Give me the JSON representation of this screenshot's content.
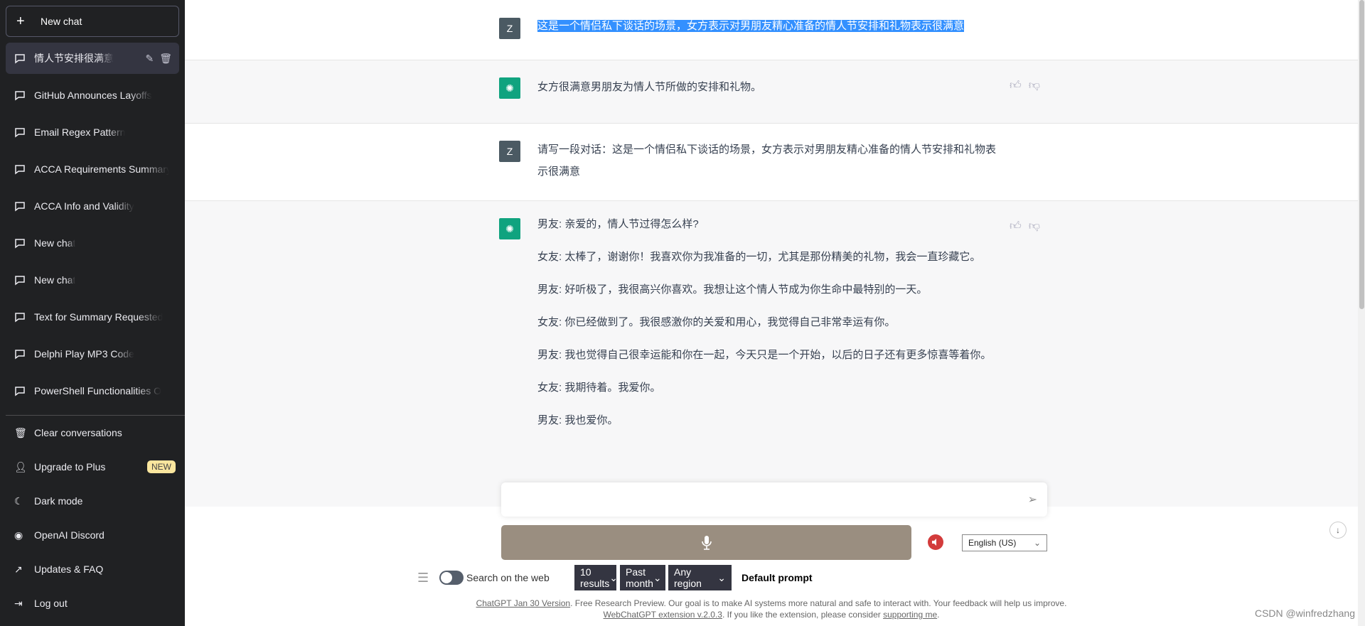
{
  "sidebar": {
    "new_chat": "New chat",
    "conversations": [
      {
        "label": "情人节安排很满意",
        "selected": true
      },
      {
        "label": "GitHub Announces Layoffs"
      },
      {
        "label": "Email Regex Pattern"
      },
      {
        "label": "ACCA Requirements Summary"
      },
      {
        "label": "ACCA Info and Validity"
      },
      {
        "label": "New chat"
      },
      {
        "label": "New chat"
      },
      {
        "label": "Text for Summary Requested"
      },
      {
        "label": "Delphi Play MP3 Code"
      },
      {
        "label": "PowerShell Functionalities O"
      }
    ],
    "menu": [
      {
        "label": "Clear conversations",
        "icon": "trash-icon"
      },
      {
        "label": "Upgrade to Plus",
        "icon": "user-icon",
        "badge": "NEW"
      },
      {
        "label": "Dark mode",
        "icon": "moon-icon"
      },
      {
        "label": "OpenAI Discord",
        "icon": "discord-icon"
      },
      {
        "label": "Updates & FAQ",
        "icon": "external-link-icon"
      },
      {
        "label": "Log out",
        "icon": "logout-icon"
      }
    ]
  },
  "chat": {
    "user_initial": "Z",
    "messages": [
      {
        "role": "user",
        "text": "这是一个情侣私下谈话的场景，女方表示对男朋友精心准备的情人节安排和礼物表示很满意"
      },
      {
        "role": "assistant",
        "text": "女方很满意男朋友为情人节所做的安排和礼物。"
      },
      {
        "role": "user",
        "text": "请写一段对话：这是一个情侣私下谈话的场景，女方表示对男朋友精心准备的情人节安排和礼物表示很满意"
      },
      {
        "role": "assistant",
        "paragraphs": [
          "男友: 亲爱的，情人节过得怎么样?",
          "女友: 太棒了，谢谢你！我喜欢你为我准备的一切，尤其是那份精美的礼物，我会一直珍藏它。",
          "男友: 好听极了，我很高兴你喜欢。我想让这个情人节成为你生命中最特别的一天。",
          "女友: 你已经做到了。我很感激你的关爱和用心，我觉得自己非常幸运有你。",
          "男友: 我也觉得自己很幸运能和你在一起，今天只是一个开始，以后的日子还有更多惊喜等着你。",
          "女友: 我期待着。我爱你。",
          "男友: 我也爱你。"
        ]
      }
    ]
  },
  "composer": {
    "placeholder": "",
    "language": "English (US)"
  },
  "web": {
    "toggle_label": "Search on the web",
    "results": "10 results",
    "time": "Past month",
    "region": "Any region",
    "prompt": "Default prompt"
  },
  "footer": {
    "version_link": "ChatGPT Jan 30 Version",
    "line1": ". Free Research Preview. Our goal is to make AI systems more natural and safe to interact with. Your feedback will help us improve.",
    "ext_link": "WebChatGPT extension v.2.0.3",
    "line2": ". If you like the extension, please consider ",
    "support_link": "supporting me",
    "end": "."
  },
  "watermark": "CSDN @winfredzhang"
}
